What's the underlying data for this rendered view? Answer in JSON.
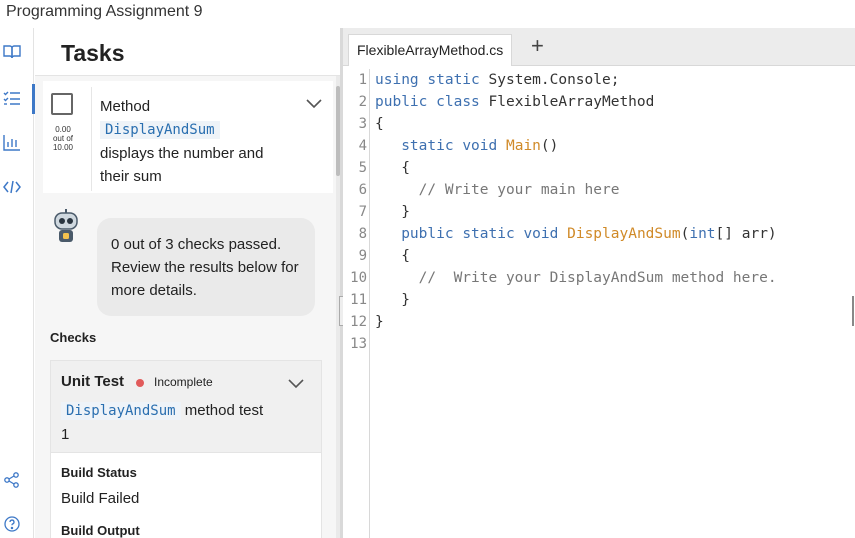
{
  "window": {
    "title": "Programming Assignment 9"
  },
  "sidebar_rail": {
    "icons": [
      "book-icon",
      "tasks-list-icon",
      "chart-icon",
      "code-icon",
      "share-icon",
      "help-icon"
    ]
  },
  "tasks_panel": {
    "title": "Tasks",
    "task": {
      "title_prefix": "Method",
      "method_chip": "DisplayAndSum",
      "description": "displays the number and their sum",
      "score_value": "0.00",
      "score_out_of": "out of",
      "score_total": "10.00"
    },
    "feedback": {
      "message": "0 out of 3 checks passed. Review the results below for more details."
    },
    "checks": {
      "label": "Checks",
      "unit_test": {
        "title": "Unit Test",
        "status": "Incomplete",
        "status_color": "#e15b5b",
        "method_chip": "DisplayAndSum",
        "description": "method test",
        "number": "1"
      },
      "build_status": {
        "label": "Build Status",
        "value": "Build Failed",
        "next_label": "Build Output"
      }
    }
  },
  "editor": {
    "tab_label": "FlexibleArrayMethod.cs",
    "add_tab_label": "+",
    "line_numbers": [
      "1",
      "2",
      "3",
      "4",
      "5",
      "6",
      "7",
      "8",
      "9",
      "10",
      "11",
      "12",
      "13"
    ],
    "lines": [
      "using static System.Console;",
      "public class FlexibleArrayMethod",
      "{",
      "   static void Main()",
      "   {",
      "     // Write your main here",
      "   }",
      "   public static void DisplayAndSum(int[] arr)",
      "   {",
      "     //  Write your DisplayAndSum method here.",
      "   }",
      "}",
      ""
    ]
  }
}
